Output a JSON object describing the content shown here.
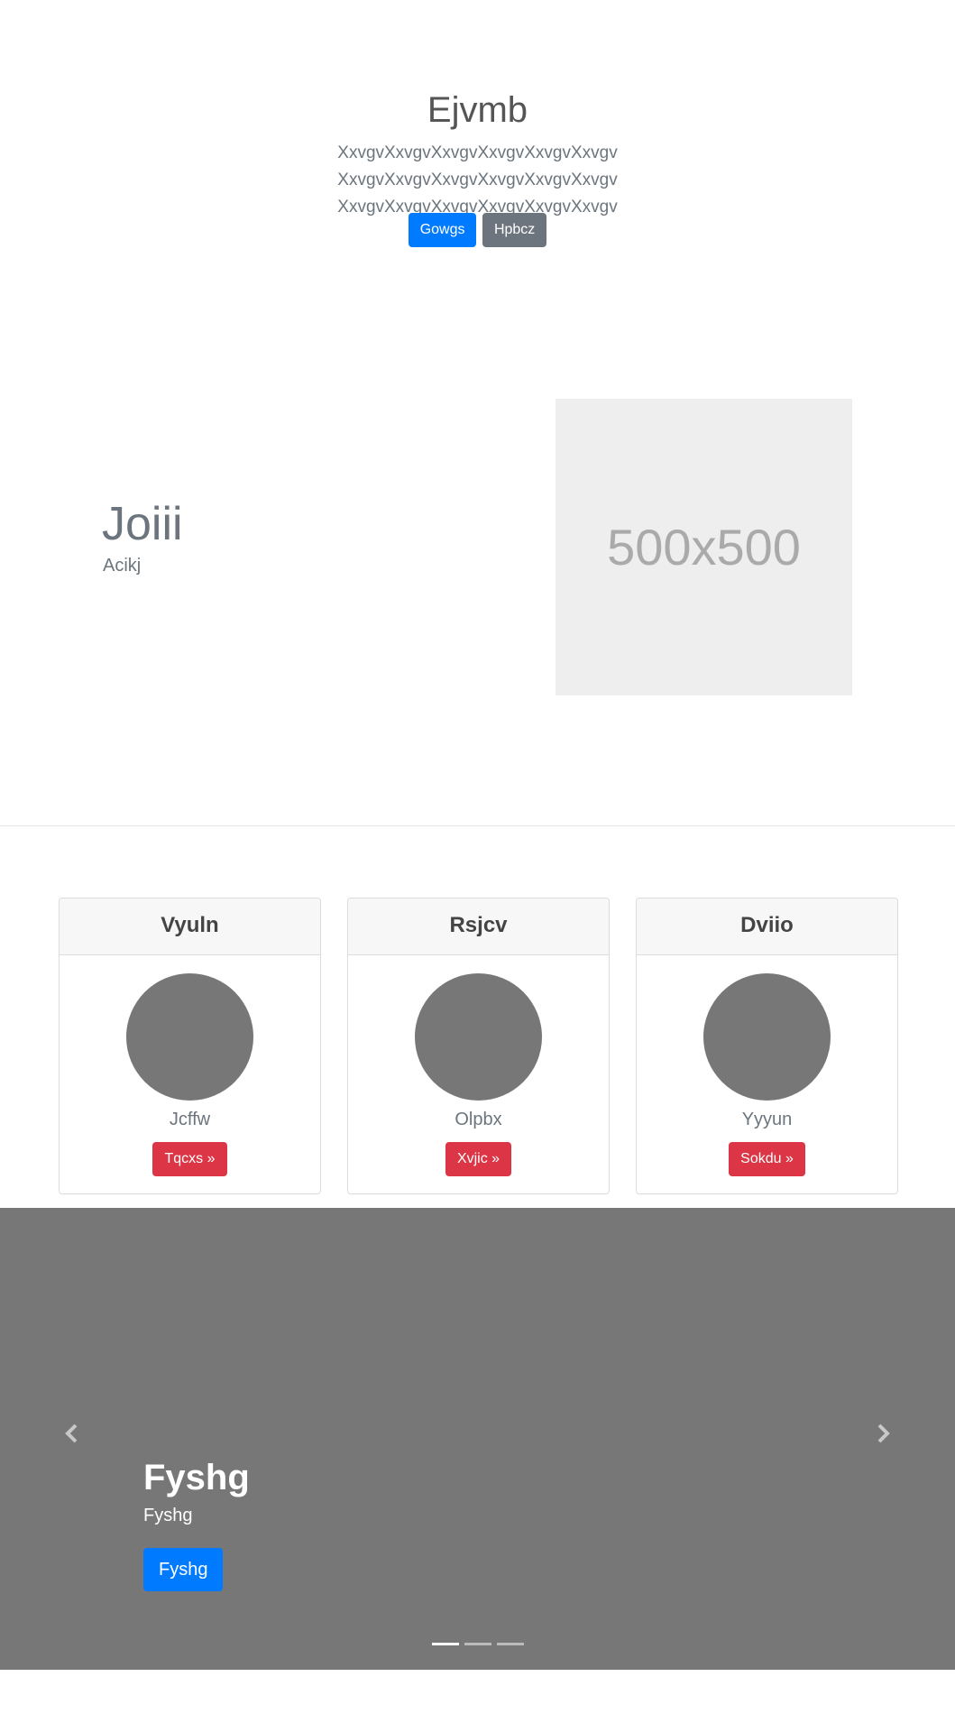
{
  "hero": {
    "title": "Ejvmb",
    "lead": "XxvgvXxvgvXxvgvXxvgvXxvgvXxvgv XxvgvXxvgvXxvgvXxvgvXxvgvXxvgv XxvgvXxvgvXxvgvXxvgvXxvgvXxvgv",
    "primary_button": "Gowgs",
    "secondary_button": "Hpbcz"
  },
  "feature": {
    "heading": "Joiii",
    "subheading": "Acikj",
    "image_placeholder": "500x500"
  },
  "cards": [
    {
      "title": "Vyuln",
      "text": "Jcffw",
      "button": "Tqcxs »"
    },
    {
      "title": "Rsjcv",
      "text": "Olpbx",
      "button": "Xvjic »"
    },
    {
      "title": "Dviio",
      "text": "Yyyun",
      "button": "Sokdu »"
    }
  ],
  "carousel": {
    "prev_icon": "chevron-left-icon",
    "next_icon": "chevron-right-icon",
    "caption_title": "Fyshg",
    "caption_text": "Fyshg",
    "caption_button": "Fyshg",
    "slide_count": 3,
    "active_slide": 1
  },
  "colors": {
    "primary": "#007bff",
    "secondary": "#6c757d",
    "danger": "#dc3545",
    "carousel_bg": "#777777",
    "placeholder_bg": "#eeeeee"
  }
}
